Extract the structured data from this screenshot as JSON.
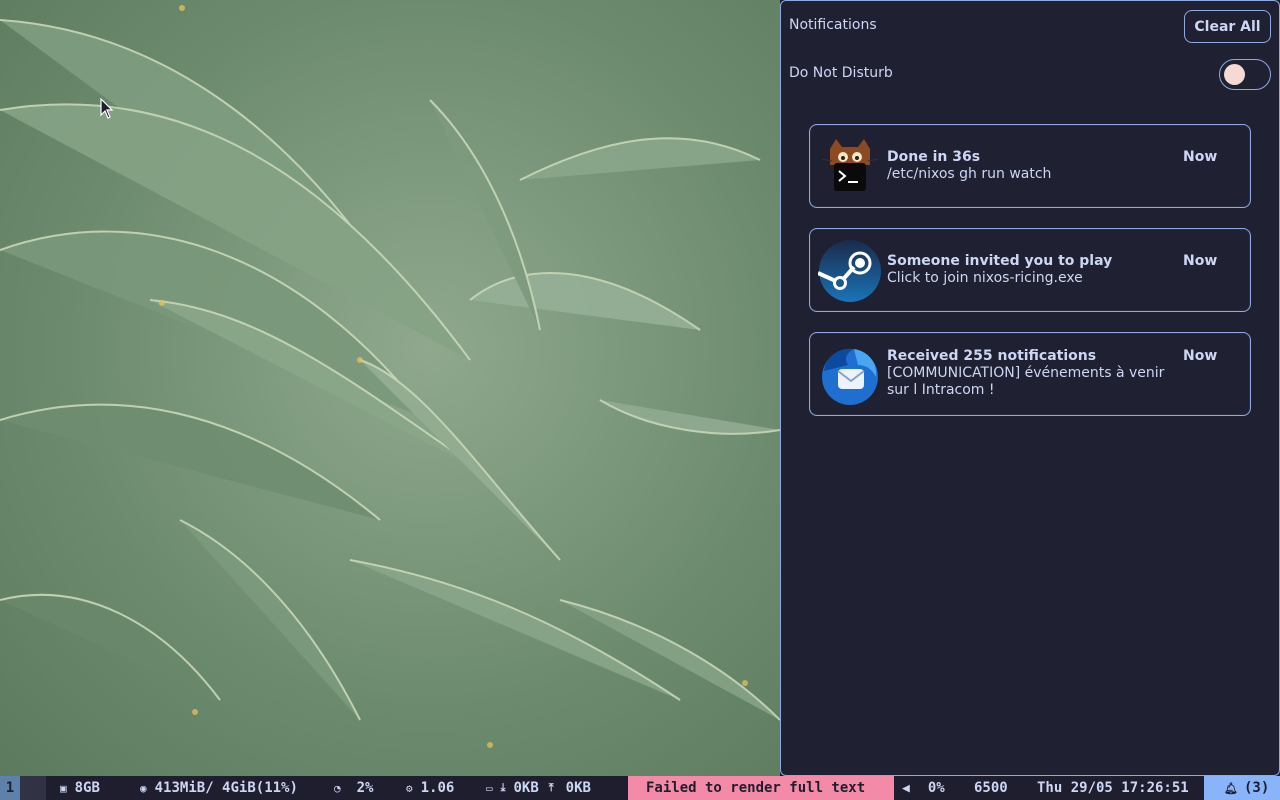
{
  "panel": {
    "title": "Notifications",
    "clear_label": "Clear All",
    "dnd_label": "Do Not Disturb",
    "dnd_enabled": false
  },
  "notifications": [
    {
      "app_icon": "terminal-cat-icon",
      "title": "Done in 36s",
      "body": "/etc/nixos gh run watch",
      "time": "Now"
    },
    {
      "app_icon": "steam-icon",
      "title": "Someone invited you to play",
      "body": "Click to join nixos-ricing.exe",
      "time": "Now"
    },
    {
      "app_icon": "thunderbird-icon",
      "title": "Received 255 notifications",
      "body": "[COMMUNICATION] événements à venir sur l Intracom !",
      "time": "Now"
    }
  ],
  "statusbar": {
    "workspace": "1",
    "memory": "8GB",
    "disk": "413MiB/ 4GiB(11%)",
    "cpu": "2%",
    "load": "1.06",
    "net_down": "0KB",
    "net_up": "0KB",
    "error_text": "Failed to render full text",
    "volume": "0%",
    "brightness": "6500",
    "clock": "Thu 29/05 17:26:51",
    "notif_count": "(3)"
  },
  "colors": {
    "accent": "#8fa9e3",
    "panel_bg": "#1f2031",
    "error_bg": "#f38ba8",
    "notif_bg": "#89b4fa",
    "workspace_bg": "#5e81ac"
  }
}
